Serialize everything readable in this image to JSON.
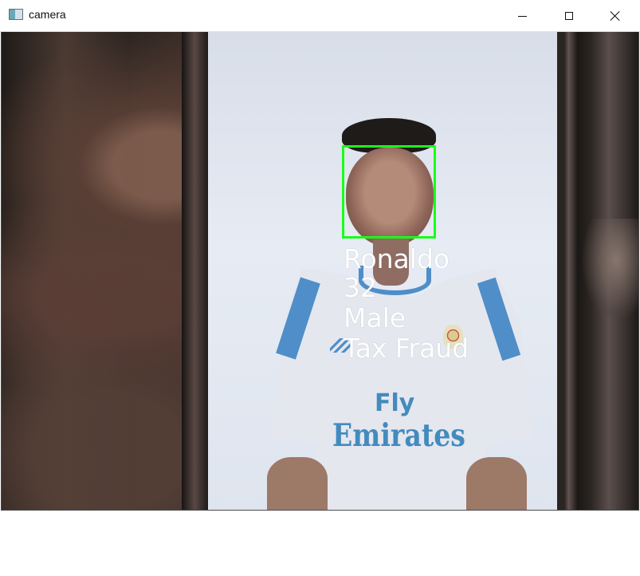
{
  "window": {
    "title": "camera",
    "controls": {
      "minimize": "minimize-icon",
      "maximize": "maximize-icon",
      "close": "close-icon"
    }
  },
  "camera": {
    "detection": {
      "name": "Ronaldo",
      "age": "32",
      "gender": "Male",
      "crime": "Tax Fraud",
      "box_color": "#18ff18",
      "text_color": "#ffffff"
    },
    "jersey": {
      "line1": "Fly",
      "line2": "Emirates"
    }
  }
}
